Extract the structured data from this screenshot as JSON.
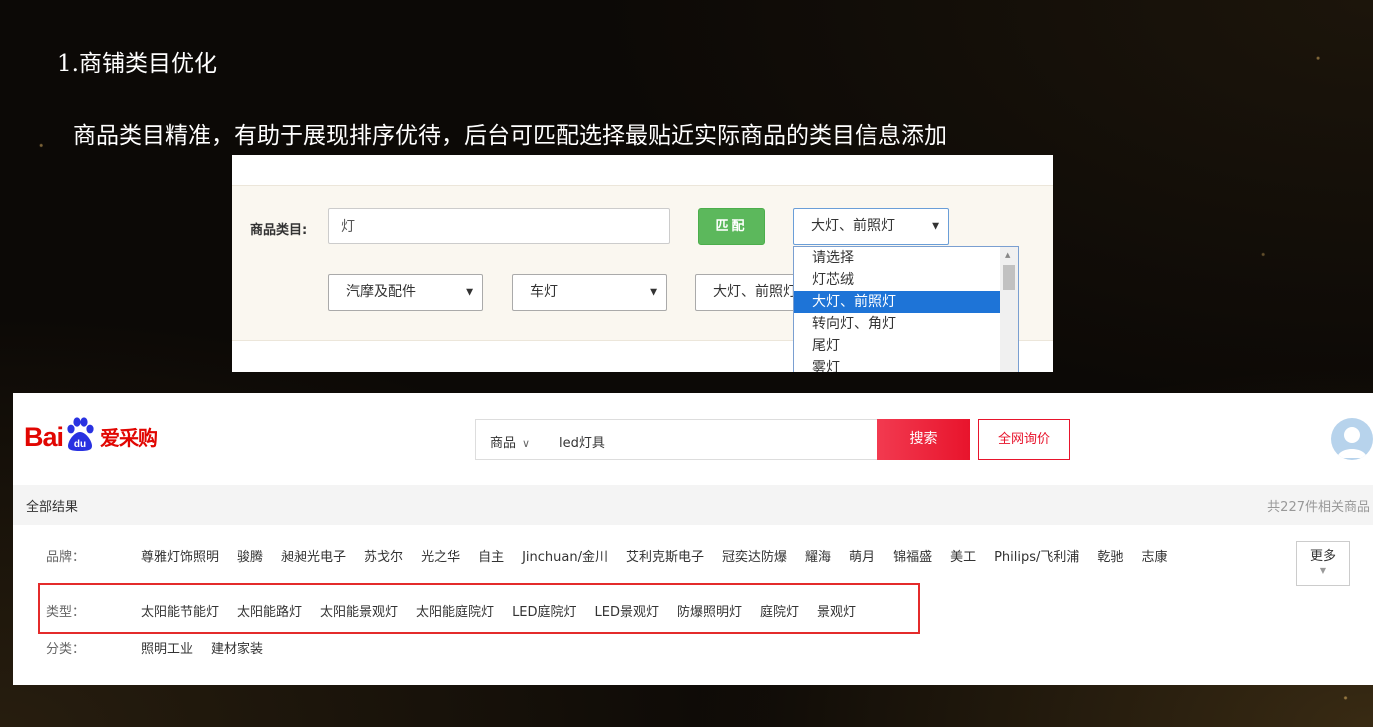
{
  "slide": {
    "title": "1.商铺类目优化",
    "subtitle": "商品类目精准，有助于展现排序优待，后台可匹配选择最贴近实际商品的类目信息添加"
  },
  "category_matcher": {
    "label": "商品类目:",
    "input_value": "灯",
    "match_button": "匹配",
    "selected_category": "大灯、前照灯",
    "selects": [
      "汽摩及配件",
      "车灯",
      "大灯、前照灯"
    ],
    "dropdown_options": [
      "请选择",
      "灯芯绒",
      "大灯、前照灯",
      "转向灯、角灯",
      "尾灯",
      "雾灯"
    ],
    "dropdown_selected_index": 2
  },
  "aicaigou": {
    "logo_prefix": "Bai",
    "logo_paw_text": "du",
    "logo_suffix": "爱采购",
    "search_scope": "商品",
    "search_query": "led灯具",
    "search_button": "搜索",
    "inquiry_button": "全网询价",
    "all_results": "全部结果",
    "result_count": "共227件相关商品",
    "brand_label": "品牌：",
    "brands": [
      "尊雅灯饰照明",
      "骏腾",
      "昶昶光电子",
      "苏戈尔",
      "光之华",
      "自主",
      "Jinchuan/金川",
      "艾利克斯电子",
      "冠奕达防爆",
      "耀海",
      "萌月",
      "锦福盛",
      "美工",
      "Philips/飞利浦",
      "乾驰",
      "志康"
    ],
    "more_button": "更多",
    "type_label": "类型：",
    "types": [
      "太阳能节能灯",
      "太阳能路灯",
      "太阳能景观灯",
      "太阳能庭院灯",
      "LED庭院灯",
      "LED景观灯",
      "防爆照明灯",
      "庭院灯",
      "景观灯"
    ],
    "class_label": "分类：",
    "classes": [
      "照明工业",
      "建材家装"
    ]
  },
  "colors": {
    "accent_red": "#e8142c",
    "match_green": "#5cb85c",
    "option_highlight": "#1e74d7",
    "highlight_box": "#e42b2b"
  }
}
